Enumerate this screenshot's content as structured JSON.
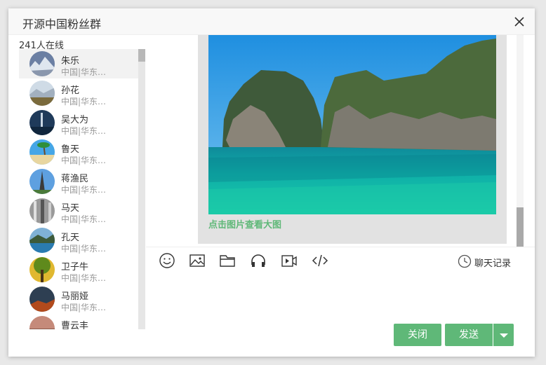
{
  "window": {
    "title": "开源中国粉丝群"
  },
  "sidebar": {
    "online_count": "241人在线",
    "members": [
      {
        "name": "朱乐",
        "sign": "中国|华东…",
        "active": true
      },
      {
        "name": "孙花",
        "sign": "中国|华东…"
      },
      {
        "name": "吴大为",
        "sign": "中国|华东…"
      },
      {
        "name": "鲁天",
        "sign": "中国|华东…"
      },
      {
        "name": "蒋渔民",
        "sign": "中国|华东…"
      },
      {
        "name": "马天",
        "sign": "中国|华东…"
      },
      {
        "name": "孔天",
        "sign": "中国|华东…"
      },
      {
        "name": "卫子牛",
        "sign": "中国|华东…"
      },
      {
        "name": "马丽娅",
        "sign": "中国|华东…"
      },
      {
        "name": "曹云丰",
        "sign": ""
      }
    ]
  },
  "chat": {
    "image_link": "点击图片查看大图"
  },
  "toolbar": {
    "icons": [
      "smiley-icon",
      "image-icon",
      "folder-icon",
      "headphones-icon",
      "video-icon",
      "code-icon"
    ],
    "history_label": "聊天记录"
  },
  "actions": {
    "close_label": "关闭",
    "send_label": "发送"
  },
  "colors": {
    "accent": "#5fb878",
    "title_bg": "#f8f8f8",
    "bubble_bg": "#e2e2e2"
  }
}
